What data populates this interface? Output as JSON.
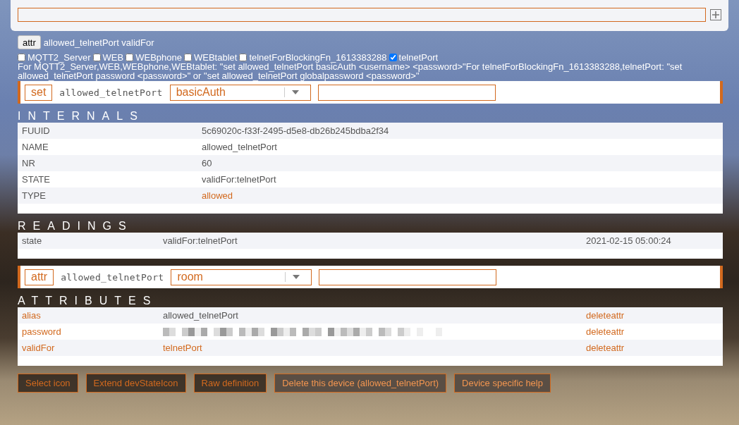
{
  "attr_line": {
    "button": "attr",
    "text": "allowed_telnetPort validFor"
  },
  "options": [
    {
      "label": "MQTT2_Server",
      "checked": false
    },
    {
      "label": "WEB",
      "checked": false
    },
    {
      "label": "WEBphone",
      "checked": false
    },
    {
      "label": "WEBtablet",
      "checked": false
    },
    {
      "label": "telnetForBlockingFn_1613383288",
      "checked": false
    },
    {
      "label": "telnetPort",
      "checked": true
    }
  ],
  "help_text": "For MQTT2_Server,WEB,WEBphone,WEBtablet: \"set allowed_telnetPort basicAuth <username> <password>\"For telnetForBlockingFn_1613383288,telnetPort: \"set allowed_telnetPort password <password>\" or \"set allowed_telnetPort globalpassword <password>\"",
  "set_bar": {
    "button": "set",
    "device": "allowed_telnetPort",
    "dropdown": "basicAuth"
  },
  "internals": {
    "title": "INTERNALS",
    "rows": [
      {
        "name": "FUUID",
        "value": "5c69020c-f33f-2495-d5e8-db26b245bdba2f34",
        "link": false
      },
      {
        "name": "NAME",
        "value": "allowed_telnetPort",
        "link": false
      },
      {
        "name": "NR",
        "value": "60",
        "link": false
      },
      {
        "name": "STATE",
        "value": "validFor:telnetPort",
        "link": false
      },
      {
        "name": "TYPE",
        "value": "allowed",
        "link": true
      }
    ]
  },
  "readings": {
    "title": "READINGS",
    "rows": [
      {
        "name": "state",
        "value": "validFor:telnetPort",
        "time": "2021-02-15 05:00:24"
      }
    ]
  },
  "attr_bar": {
    "button": "attr",
    "device": "allowed_telnetPort",
    "dropdown": "room"
  },
  "attributes": {
    "title": "ATTRIBUTES",
    "rows": [
      {
        "name": "alias",
        "value": "allowed_telnetPort",
        "value_link": false,
        "action": "deleteattr"
      },
      {
        "name": "password",
        "redacted": true,
        "action": "deleteattr"
      },
      {
        "name": "validFor",
        "value": "telnetPort",
        "value_link": true,
        "action": "deleteattr"
      }
    ]
  },
  "buttons": [
    {
      "label": "Select icon",
      "kind": "dark"
    },
    {
      "label": "Extend devStateIcon",
      "kind": "dark"
    },
    {
      "label": "Raw definition",
      "kind": "dark"
    },
    {
      "label": "Delete this device (allowed_telnetPort)",
      "kind": "dim"
    },
    {
      "label": "Device specific help",
      "kind": "dim"
    }
  ]
}
